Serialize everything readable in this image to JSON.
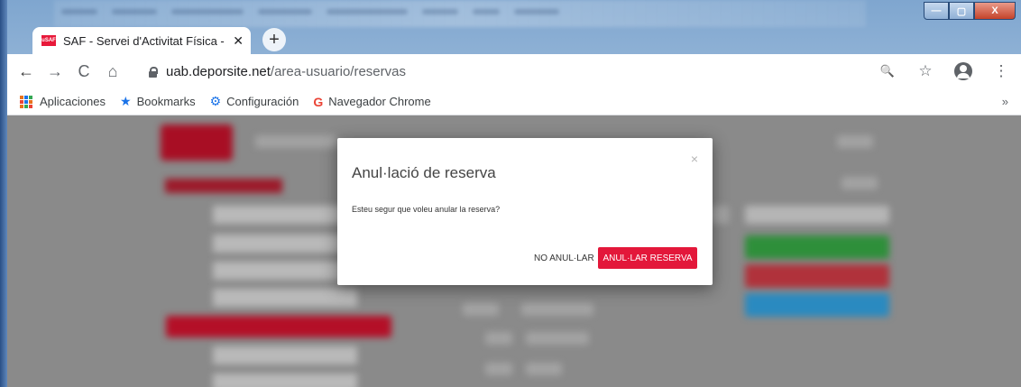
{
  "browser": {
    "tab": {
      "favicon_text": "uSAF",
      "title": "SAF - Servei d'Activitat Física - Ur",
      "close_glyph": "✕"
    },
    "new_tab_glyph": "+",
    "nav": {
      "back": "←",
      "forward": "→",
      "reload": "C",
      "home": "⌂"
    },
    "url": {
      "host": "uab.deporsite.net",
      "path": "/area-usuario/reservas"
    },
    "toolbar_icons": {
      "zoom": "🔍",
      "star": "☆",
      "menu": "⋮"
    },
    "window_buttons": {
      "minimize": "—",
      "maximize": "▢",
      "close": "X"
    }
  },
  "bookmarks": {
    "items": [
      {
        "label": "Aplicaciones",
        "icon": "apps-grid-icon"
      },
      {
        "label": "Bookmarks",
        "icon": "star-icon",
        "glyph": "★"
      },
      {
        "label": "Configuración",
        "icon": "gear-icon",
        "glyph": "⚙"
      },
      {
        "label": "Navegador Chrome",
        "icon": "google-icon",
        "glyph": "G"
      }
    ],
    "more": "»"
  },
  "modal": {
    "title": "Anul·lació de reserva",
    "message": "Esteu segur que voleu anular la reserva?",
    "close_glyph": "×",
    "cancel_label": "NO ANUL·LAR",
    "confirm_label": "ANUL·LAR RESERVA"
  },
  "colors": {
    "accent": "#e3173a",
    "google_blue": "#1a73e8"
  }
}
